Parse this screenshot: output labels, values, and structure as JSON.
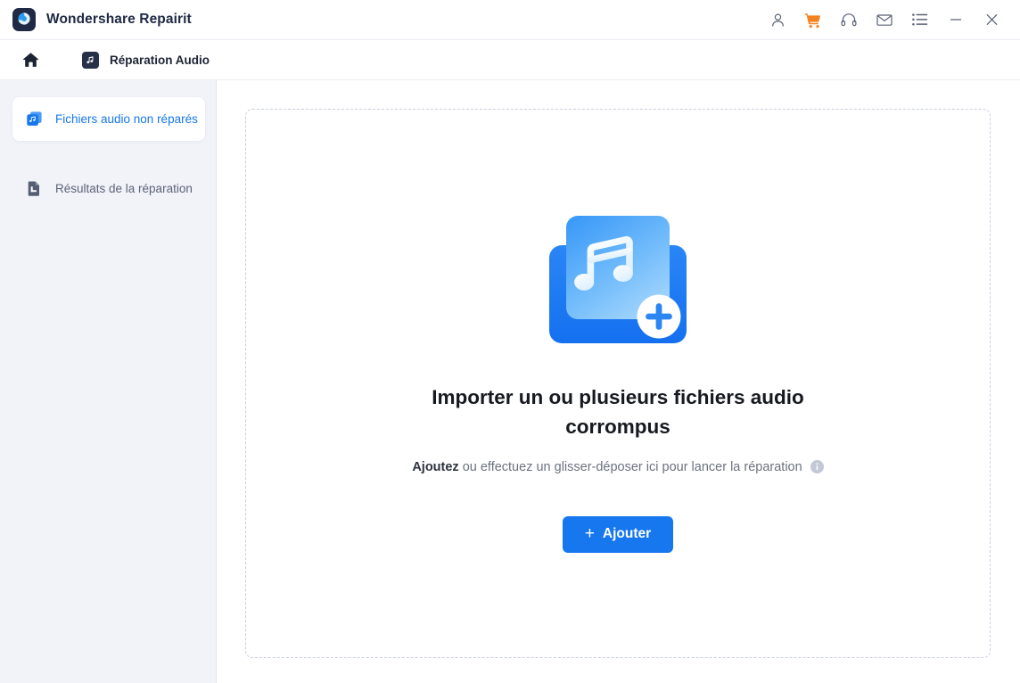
{
  "window": {
    "app_title": "Wondershare Repairit",
    "logo_icon": "wondershare-logo-icon",
    "controls": [
      {
        "name": "account-icon",
        "label": "Account"
      },
      {
        "name": "cart-icon",
        "label": "Buy",
        "color": "#f58220"
      },
      {
        "name": "support-icon",
        "label": "Support"
      },
      {
        "name": "mail-icon",
        "label": "Mail"
      },
      {
        "name": "menu-list-icon",
        "label": "Menu"
      },
      {
        "name": "minimize-icon",
        "label": "Minimize"
      },
      {
        "name": "close-icon",
        "label": "Close"
      }
    ]
  },
  "breadcrumb": {
    "home_icon": "home-icon",
    "module_icon": "audio-repair-icon",
    "module_label": "Réparation Audio"
  },
  "sidebar": {
    "items": [
      {
        "icon": "audio-files-icon",
        "label": "Fichiers audio non réparés",
        "active": true
      },
      {
        "icon": "repair-results-icon",
        "label": "Résultats de la réparation",
        "active": false
      }
    ]
  },
  "main": {
    "dropzone_icon": "add-audio-file-icon",
    "title": "Importer un ou plusieurs fichiers audio corrompus",
    "subtitle_strong": "Ajoutez",
    "subtitle_rest": "ou effectuez un glisser-déposer ici pour lancer la réparation",
    "info_icon": "info-icon",
    "add_button_plus": "+",
    "add_button_label": "Ajouter"
  },
  "colors": {
    "accent": "#1677ef",
    "cart": "#f58220",
    "sidebar_bg": "#f1f3f9",
    "title_text": "#202a44",
    "dashed_border": "#c9cfe0"
  }
}
